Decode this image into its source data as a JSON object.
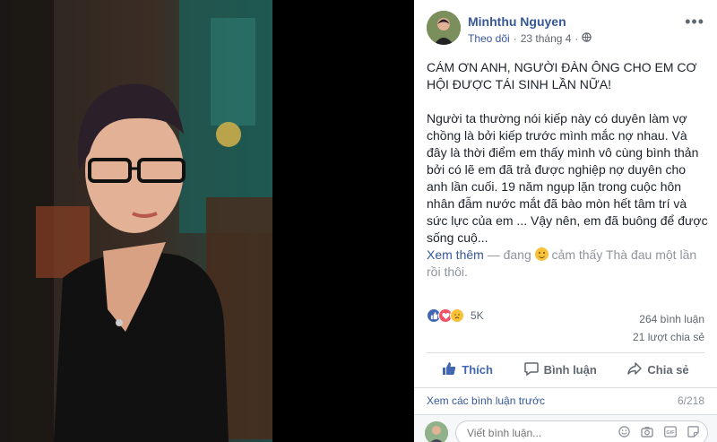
{
  "post": {
    "author": "Minhthu Nguyen",
    "follow": "Theo dõi",
    "date": "23 tháng 4",
    "heading": "CÁM ƠN ANH, NGƯỜI ĐÀN ÔNG CHO EM CƠ HỘI ĐƯỢC TÁI SINH LẦN NỮA!",
    "body": "Người ta thường nói kiếp này có duyên làm vợ chồng là bởi kiếp trước mình mắc nợ nhau. Và đây là thời điểm em thấy mình vô cùng bình thản bởi có lẽ em đã trả được nghiệp nợ duyên cho anh lần cuối. 19 năm ngụp lặn trong cuộc hôn nhân đẫm nước mắt đã bào mòn hết tâm trí và sức lực của em ... Vậy nên, em đã buông để được sống cuộ...",
    "see_more": "Xem thêm",
    "feeling_text": "— đang",
    "feeling_rest": "cảm thấy Thà đau một lần rồi thôi.",
    "more_label": "•••"
  },
  "reactions": {
    "count": "5K",
    "comments": "264 bình luận",
    "shares": "21 lượt chia sẻ"
  },
  "actions": {
    "like": "Thích",
    "comment": "Bình luận",
    "share": "Chia sẻ"
  },
  "comments": {
    "prev": "Xem các bình luận trước",
    "count": "6/218",
    "placeholder": "Viết bình luận..."
  },
  "colors": {
    "link": "#365899",
    "like_blue": "#4267b2",
    "text": "#1d2129",
    "muted": "#616770"
  },
  "icons": [
    "globe-icon",
    "like-icon",
    "love-icon",
    "sad-icon",
    "thumb-icon",
    "speech-bubble-icon",
    "share-arrow-icon",
    "emoji-icon",
    "camera-icon",
    "gif-icon",
    "sticker-icon"
  ]
}
